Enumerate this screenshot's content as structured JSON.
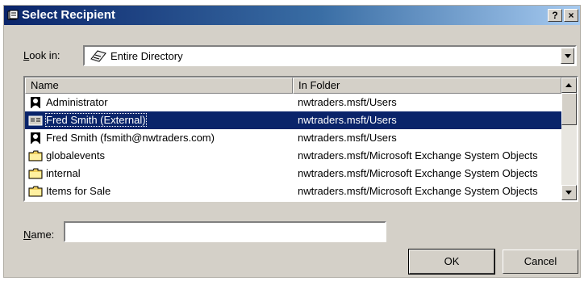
{
  "dialog": {
    "title": "Select Recipient",
    "help_glyph": "?",
    "close_glyph": "×"
  },
  "look_in": {
    "label_accel": "L",
    "label_rest": "ook in:",
    "value": "Entire Directory",
    "icon": "address-book-icon"
  },
  "list": {
    "columns": [
      "Name",
      "In Folder"
    ],
    "rows": [
      {
        "name": "Administrator",
        "folder": "nwtraders.msft/Users",
        "icon": "user-icon",
        "selected": false
      },
      {
        "name": "Fred Smith (External)",
        "folder": "nwtraders.msft/Users",
        "icon": "contact-icon",
        "selected": true
      },
      {
        "name": "Fred Smith (fsmith@nwtraders.com)",
        "folder": "nwtraders.msft/Users",
        "icon": "user-icon",
        "selected": false
      },
      {
        "name": "globalevents",
        "folder": "nwtraders.msft/Microsoft Exchange System Objects",
        "icon": "public-folder-icon",
        "selected": false
      },
      {
        "name": "internal",
        "folder": "nwtraders.msft/Microsoft Exchange System Objects",
        "icon": "public-folder-icon",
        "selected": false
      },
      {
        "name": "Items for Sale",
        "folder": "nwtraders.msft/Microsoft Exchange System Objects",
        "icon": "public-folder-icon",
        "selected": false
      }
    ]
  },
  "name_field": {
    "label_accel": "N",
    "label_rest": "ame:",
    "value": ""
  },
  "buttons": {
    "ok": "OK",
    "cancel": "Cancel"
  },
  "colors": {
    "title_gradient_start": "#0a246a",
    "title_gradient_end": "#a6caf0",
    "face": "#d4d0c8",
    "selection": "#0a246a"
  }
}
